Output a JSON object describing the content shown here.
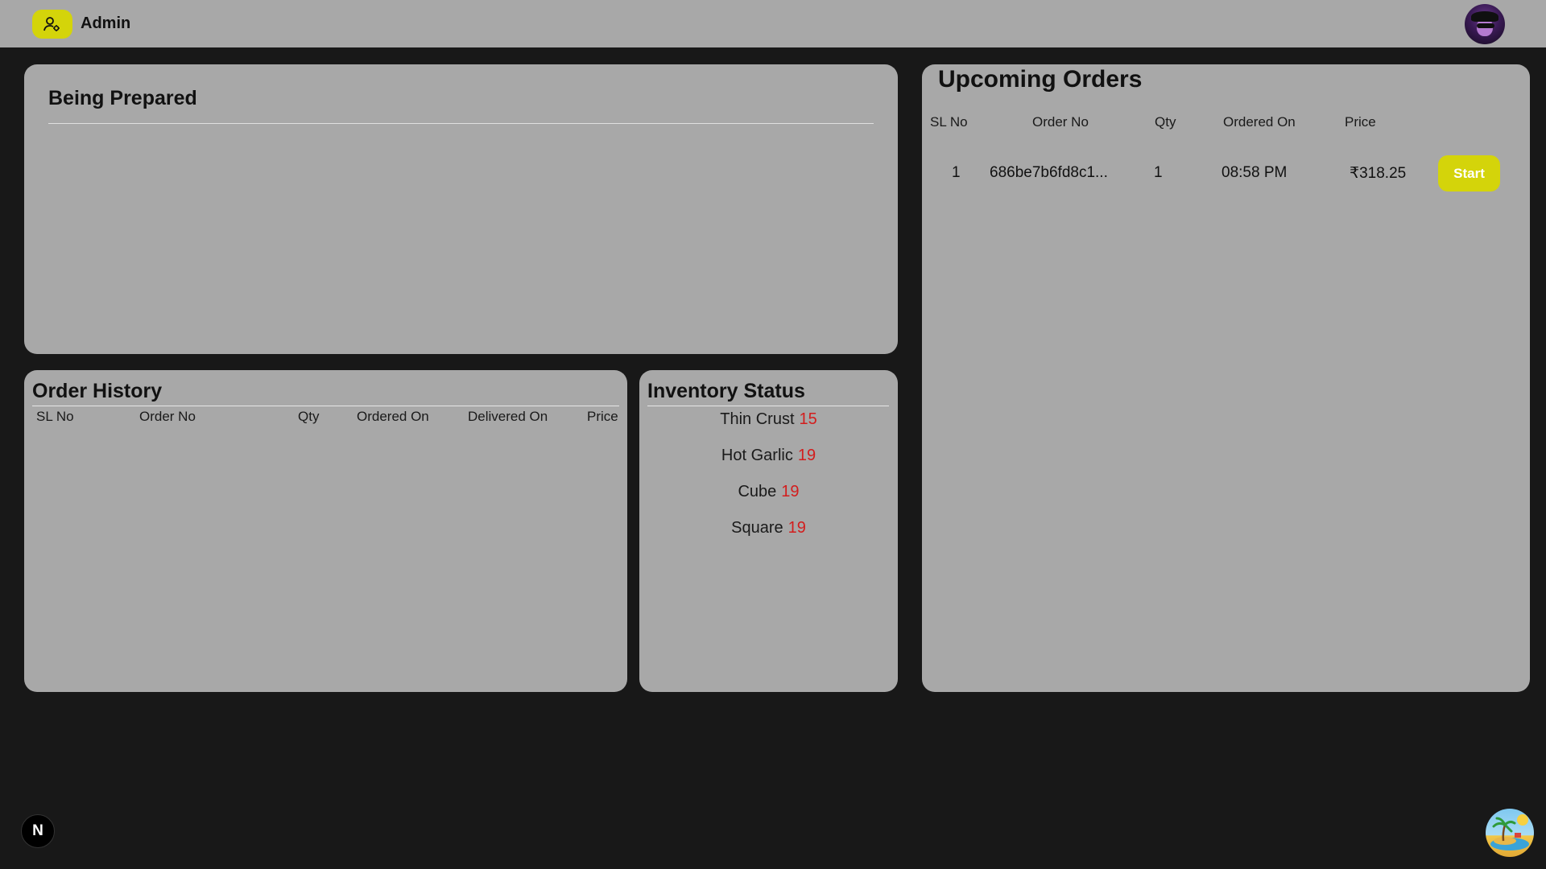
{
  "header": {
    "title": "Admin",
    "icons": {
      "admin": "user-gear-icon",
      "avatar": "profile-avatar"
    }
  },
  "being_prepared": {
    "title": "Being Prepared"
  },
  "order_history": {
    "title": "Order History",
    "columns": [
      "SL No",
      "Order No",
      "Qty",
      "Ordered On",
      "Delivered On",
      "Price"
    ],
    "rows": []
  },
  "inventory": {
    "title": "Inventory Status",
    "items": [
      {
        "name": "Thin Crust",
        "count": "15"
      },
      {
        "name": "Hot Garlic",
        "count": "19"
      },
      {
        "name": "Cube",
        "count": "19"
      },
      {
        "name": "Square",
        "count": "19"
      }
    ]
  },
  "upcoming_orders": {
    "title": "Upcoming Orders",
    "columns": [
      "SL No",
      "Order No",
      "Qty",
      "Ordered On",
      "Price"
    ],
    "rows": [
      {
        "sl": "1",
        "order_no": "686be7b6fd8c1...",
        "qty": "1",
        "ordered_on": "08:58 PM",
        "price": "₹318.25",
        "action": "Start"
      }
    ]
  },
  "footer": {
    "dev_badge": "N",
    "icons": {
      "bottom_right": "island-icon"
    }
  },
  "colors": {
    "background": "#181818",
    "panel": "#a8a8a8",
    "accent": "#d4d40a",
    "count": "#d31d1d"
  }
}
